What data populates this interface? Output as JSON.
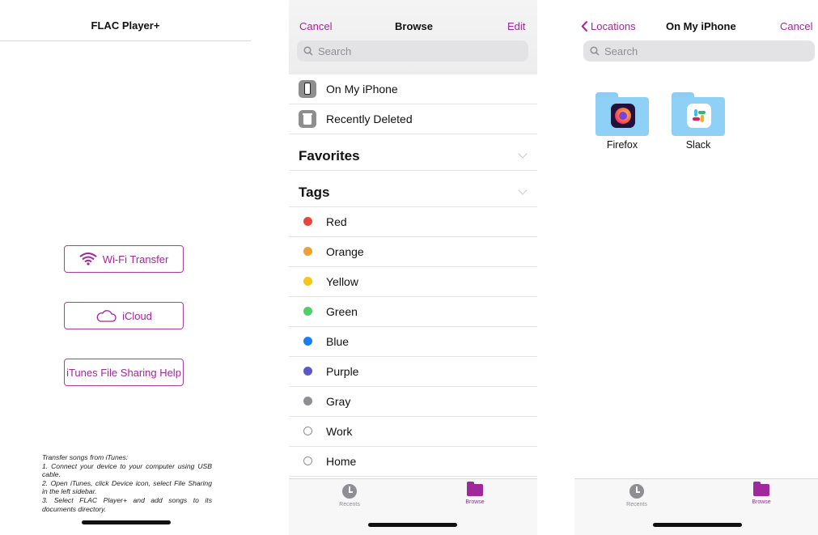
{
  "screen1": {
    "title": "FLAC Player+",
    "buttons": {
      "wifi": "Wi-Fi Transfer",
      "icloud": "iCloud",
      "itunes": "iTunes File Sharing Help"
    },
    "help_lines": [
      "Transfer songs from iTunes:",
      "1. Connect your device to your computer using USB cable.",
      "2. Open iTunes, click Device icon, select File Sharing in the left sidebar.",
      "3. Select FLAC Player+ and add songs to its documents directory."
    ]
  },
  "screen2": {
    "cancel": "Cancel",
    "title": "Browse",
    "edit": "Edit",
    "search_placeholder": "Search",
    "locations": [
      "On My iPhone",
      "Recently Deleted"
    ],
    "favorites_header": "Favorites",
    "tags_header": "Tags",
    "tags": [
      {
        "label": "Red",
        "color": "#e8453c"
      },
      {
        "label": "Orange",
        "color": "#f0a030"
      },
      {
        "label": "Yellow",
        "color": "#f5c518"
      },
      {
        "label": "Green",
        "color": "#4cd068"
      },
      {
        "label": "Blue",
        "color": "#1a7ff0"
      },
      {
        "label": "Purple",
        "color": "#5b57c8"
      },
      {
        "label": "Gray",
        "color": "#8e8e93"
      },
      {
        "label": "Work",
        "color": ""
      },
      {
        "label": "Home",
        "color": ""
      }
    ],
    "tabs": {
      "recents": "Recents",
      "browse": "Browse"
    }
  },
  "screen3": {
    "back": "Locations",
    "title": "On My iPhone",
    "cancel": "Cancel",
    "search_placeholder": "Search",
    "folders": [
      "Firefox",
      "Slack"
    ],
    "tabs": {
      "recents": "Recents",
      "browse": "Browse"
    }
  },
  "colors": {
    "accent": "#a0279c",
    "folder": "#8fd0f7"
  }
}
